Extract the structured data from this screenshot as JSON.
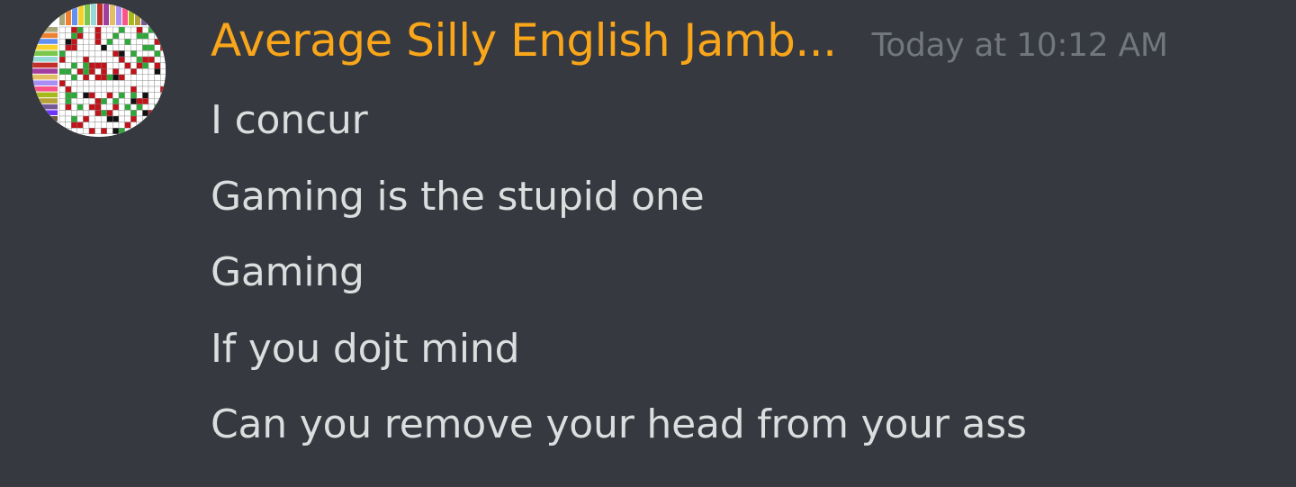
{
  "message": {
    "author": {
      "username": "Average Silly English Jamb...",
      "name_color": "#faa61a",
      "avatar_icon": "grid-chart-avatar"
    },
    "timestamp": "Today at 10:12 AM",
    "lines": [
      "I concur",
      "Gaming is the stupid one",
      "Gaming",
      "If you dojt mind",
      "Can you remove your head from your ass"
    ]
  },
  "theme": {
    "background": "#36393f",
    "text": "#dcddde",
    "timestamp": "#72767d"
  }
}
